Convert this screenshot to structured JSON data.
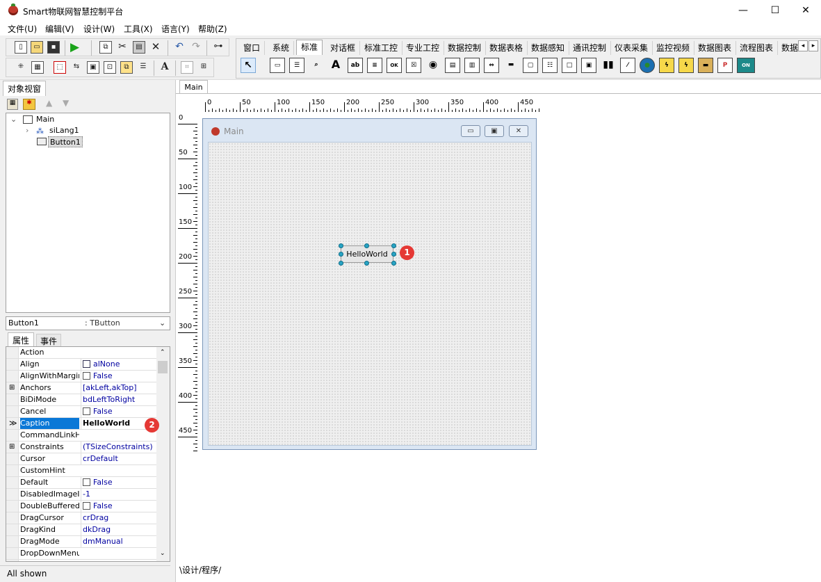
{
  "app": {
    "title": "Smart物联网智慧控制平台"
  },
  "window_controls": {
    "minimize": "—",
    "maximize": "☐",
    "close": "✕"
  },
  "menu": [
    "文件(U)",
    "编辑(V)",
    "设计(W)",
    "工具(X)",
    "语言(Y)",
    "帮助(Z)"
  ],
  "palette": {
    "tabs": [
      "窗口",
      "系统",
      "标准",
      "对话框",
      "标准工控",
      "专业工控",
      "数据控制",
      "数据表格",
      "数据感知",
      "通讯控制",
      "仪表采集",
      "监控视频",
      "数据图表",
      "流程图表",
      "数据"
    ],
    "active_tab": "标准",
    "scroll_left": "◂",
    "scroll_right": "▸"
  },
  "object_view": {
    "tab": "对象视窗",
    "tree": {
      "root": "Main",
      "children": [
        "siLang1",
        "Button1"
      ]
    }
  },
  "component_select": {
    "name": "Button1",
    "type": ": TButton"
  },
  "inspector": {
    "tabs": [
      "属性",
      "事件"
    ],
    "properties": [
      {
        "name": "Action",
        "value": ""
      },
      {
        "name": "Align",
        "value": "alNone",
        "icon": "align-icon"
      },
      {
        "name": "AlignWithMargins",
        "value": "False",
        "checkbox": true
      },
      {
        "name": "Anchors",
        "value": "[akLeft,akTop]",
        "expand": "⊞"
      },
      {
        "name": "BiDiMode",
        "value": "bdLeftToRight"
      },
      {
        "name": "Cancel",
        "value": "False",
        "checkbox": true
      },
      {
        "name": "Caption",
        "value": "HelloWorld",
        "selected": true,
        "marker": "≫"
      },
      {
        "name": "CommandLinkHint",
        "value": ""
      },
      {
        "name": "Constraints",
        "value": "(TSizeConstraints)",
        "expand": "⊞"
      },
      {
        "name": "Cursor",
        "value": "crDefault"
      },
      {
        "name": "CustomHint",
        "value": ""
      },
      {
        "name": "Default",
        "value": "False",
        "checkbox": true
      },
      {
        "name": "DisabledImageInd",
        "value": "-1"
      },
      {
        "name": "DoubleBuffered",
        "value": "False",
        "checkbox": true
      },
      {
        "name": "DragCursor",
        "value": "crDrag"
      },
      {
        "name": "DragKind",
        "value": "dkDrag"
      },
      {
        "name": "DragMode",
        "value": "dmManual"
      },
      {
        "name": "DropDownMenu",
        "value": ""
      }
    ]
  },
  "status": {
    "text": "All shown"
  },
  "designer": {
    "tab": "Main",
    "form_title": "Main",
    "button_caption": "HelloWorld",
    "ruler_h": [
      "0",
      "50",
      "100",
      "150",
      "200",
      "250",
      "300",
      "350",
      "400",
      "450"
    ],
    "ruler_v": [
      "0",
      "50",
      "100",
      "150",
      "200",
      "250",
      "300",
      "350",
      "400",
      "450"
    ],
    "badges": [
      "1",
      "2"
    ],
    "bottom_tabs": [
      "设计",
      "程序"
    ]
  }
}
